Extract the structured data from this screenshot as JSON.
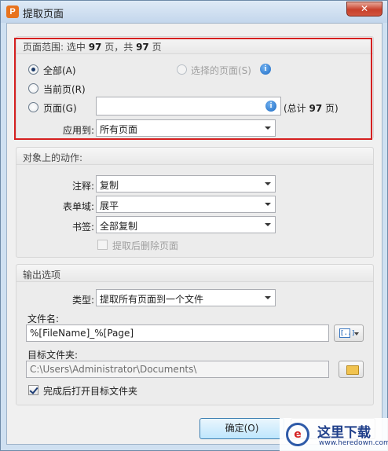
{
  "window": {
    "title": "提取页面",
    "app_icon": "P",
    "close_label": "✕"
  },
  "page_range": {
    "title_prefix": "页面范围: 选中",
    "selected_count": "97",
    "title_mid": "页，共",
    "total_count": "97",
    "title_suffix": "页",
    "radio_all": "全部(A)",
    "radio_selected": "选择的页面(S)",
    "radio_current": "当前页(R)",
    "radio_pages": "页面(G)",
    "pages_value": "",
    "total_prefix": "(总计",
    "total_pages": "97",
    "total_suffix": "页)",
    "apply_label": "应用到:",
    "apply_value": "所有页面",
    "selected": "all"
  },
  "actions": {
    "title": "对象上的动作:",
    "annotations_label": "注释:",
    "annotations_value": "复制",
    "form_fields_label": "表单域:",
    "form_fields_value": "展平",
    "bookmarks_label": "书签:",
    "bookmarks_value": "全部复制",
    "delete_after_label": "提取后删除页面",
    "delete_after_checked": false
  },
  "output": {
    "title": "输出选项",
    "type_label": "类型:",
    "type_value": "提取所有页面到一个文件",
    "filename_label": "文件名:",
    "filename_value": "%[FileName]_%[Page]",
    "folder_label": "目标文件夹:",
    "folder_value": "C:\\Users\\Administrator\\Documents\\",
    "open_after_label": "完成后打开目标文件夹",
    "open_after_checked": true
  },
  "buttons": {
    "ok": "确定(O)"
  },
  "watermark": {
    "logo": "e",
    "text": "这里下载",
    "url": "www.heredown.com"
  },
  "colors": {
    "highlight": "#d52020",
    "info_icon": "#1f6cc4"
  }
}
